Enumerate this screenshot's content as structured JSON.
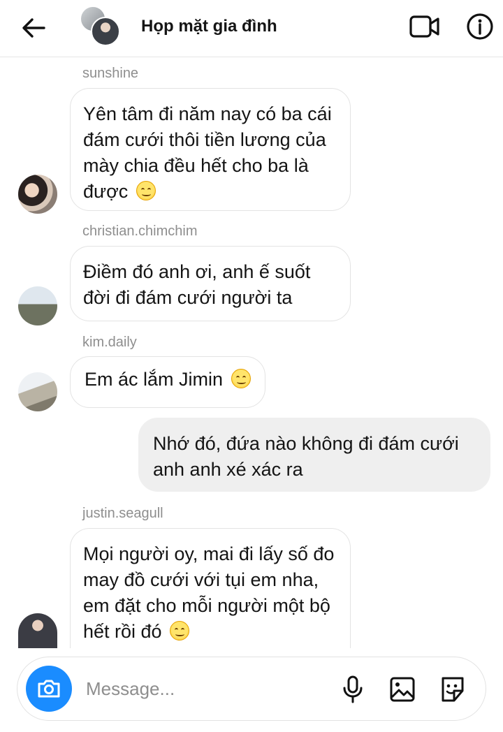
{
  "header": {
    "title": "Họp mặt gia đình",
    "icons": {
      "back": "back-arrow-icon",
      "video": "video-call-icon",
      "info": "info-icon"
    }
  },
  "messages": [
    {
      "sender": "sunshine",
      "text": "Yên tâm đi năm nay có ba cái đám cưới thôi tiền lương của mày chia đều hết cho ba là được",
      "emoji": "smiling-face-emoji"
    },
    {
      "sender": "christian.chimchim",
      "text": "Điềm đó anh ơi, anh ế suốt đời đi đám cưới người ta"
    },
    {
      "sender": "kim.daily",
      "text": "Em ác lắm Jimin",
      "emoji": "smiling-face-with-tear-emoji"
    },
    {
      "sender": "",
      "text": "Nhớ đó, đứa nào không đi đám cưới anh anh xé xác ra",
      "outgoing": true
    },
    {
      "sender": "justin.seagull",
      "text": "Mọi người oy, mai đi lấy số đo may đồ cưới với tụi em nha, em đặt cho mỗi người một bộ hết rồi đó",
      "emoji": "smiling-face-emoji"
    }
  ],
  "composer": {
    "placeholder": "Message...",
    "icons": {
      "camera": "camera-icon",
      "mic": "microphone-icon",
      "gallery": "gallery-icon",
      "sticker": "sticker-icon"
    }
  },
  "colors": {
    "accent": "#1a8cff",
    "outgoing_bubble": "#efefef",
    "sender_text": "#8e8e8e"
  }
}
